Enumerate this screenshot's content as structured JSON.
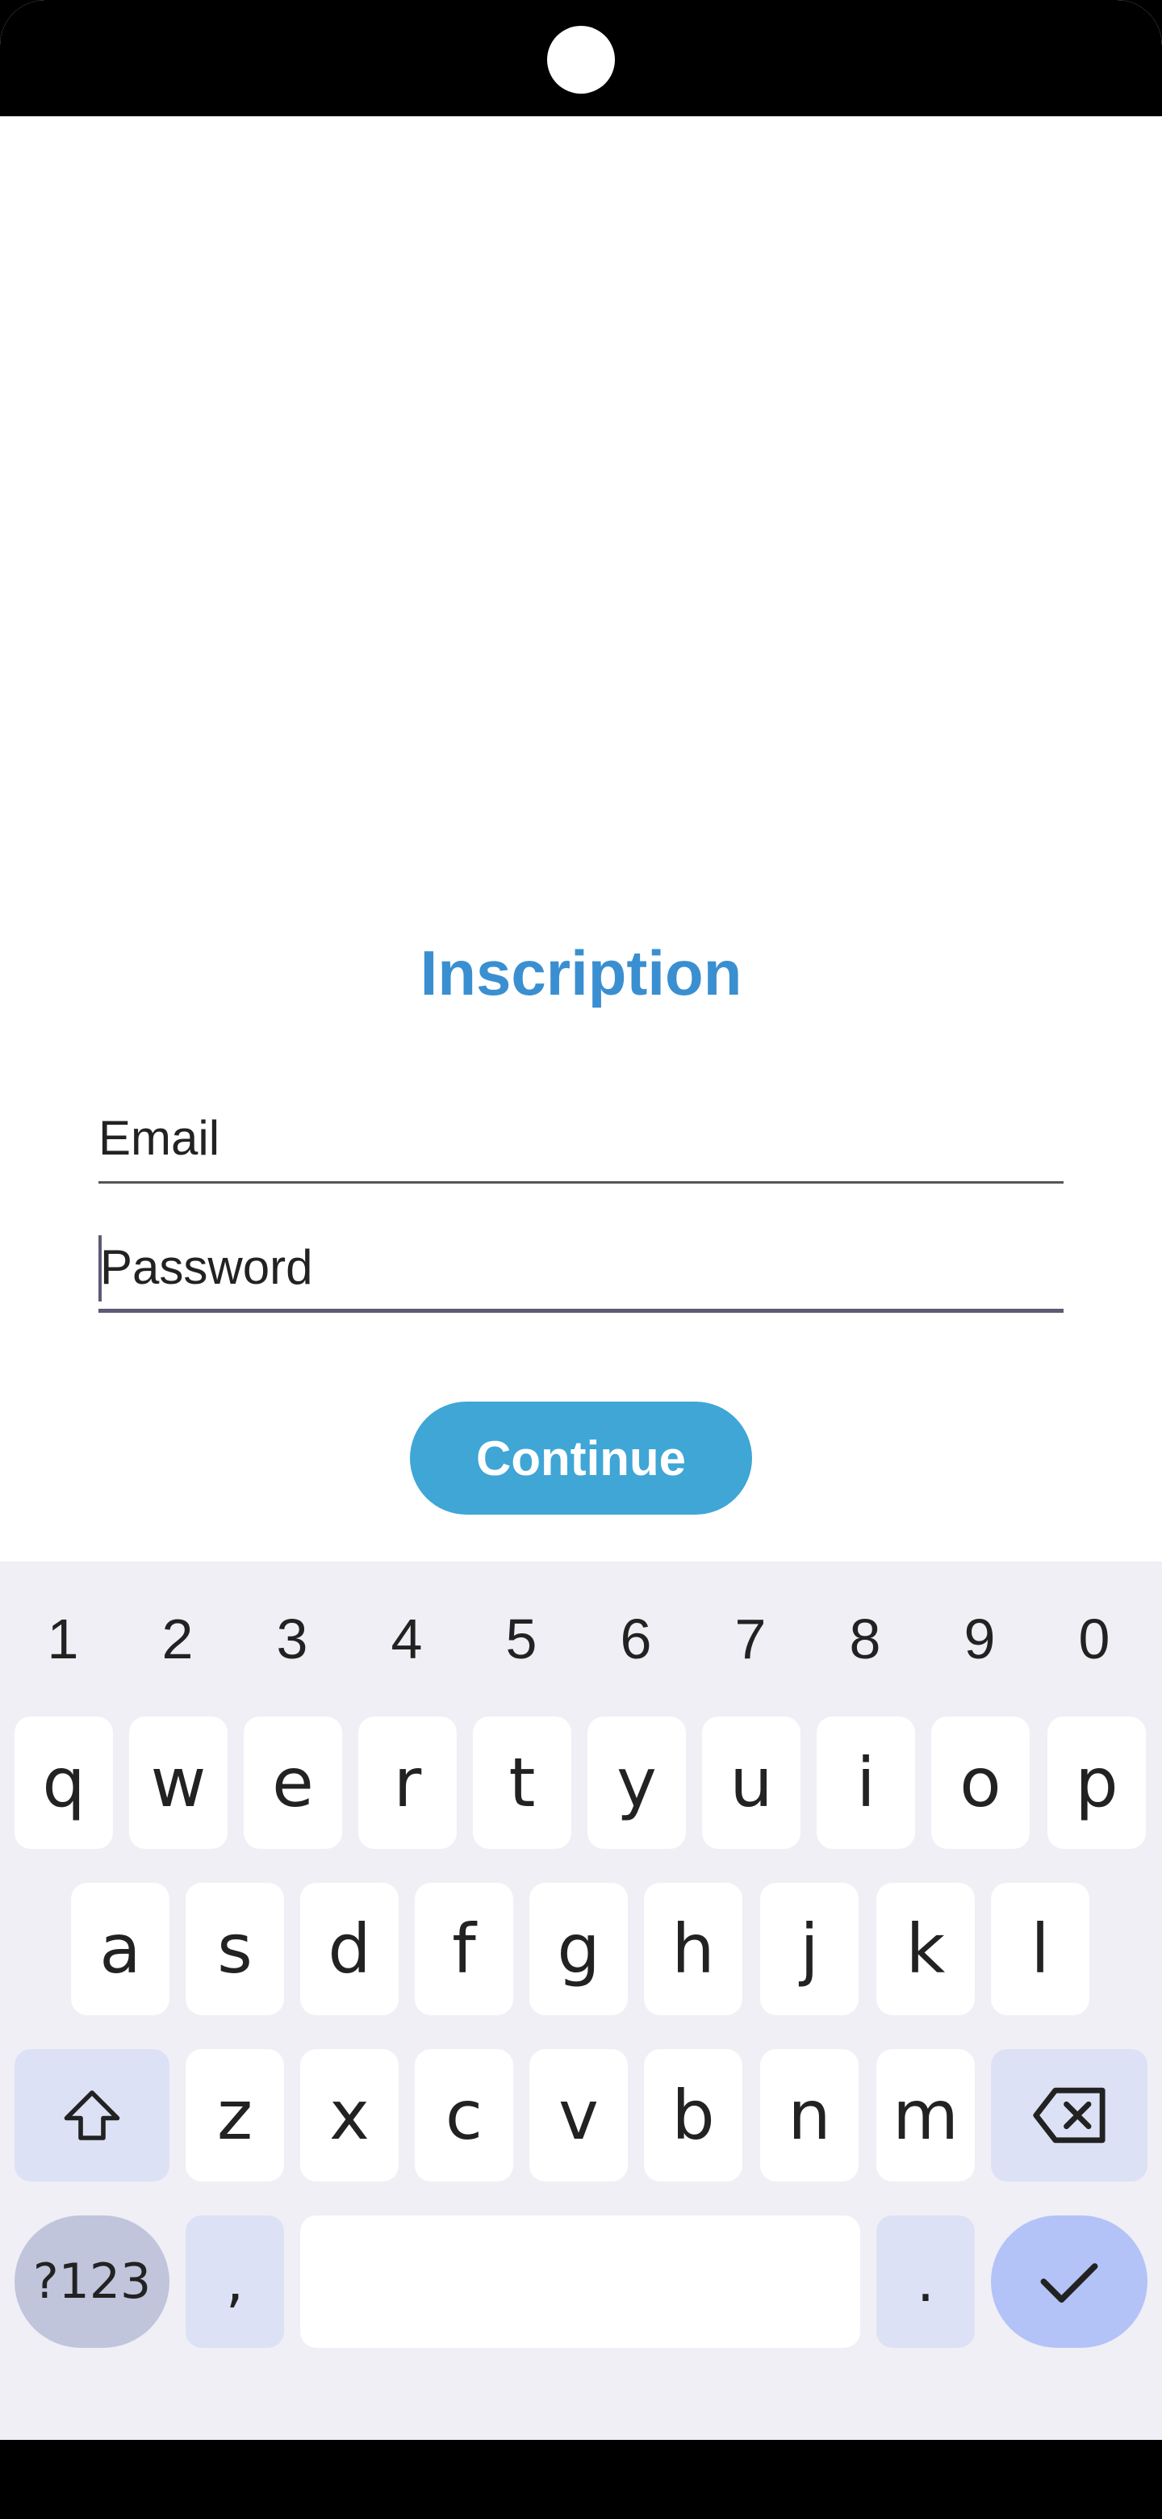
{
  "form": {
    "title": "Inscription",
    "email_placeholder": "Email",
    "password_placeholder": "Password",
    "continue_label": "Continue"
  },
  "keyboard": {
    "number_row": [
      "1",
      "2",
      "3",
      "4",
      "5",
      "6",
      "7",
      "8",
      "9",
      "0"
    ],
    "row1": [
      "q",
      "w",
      "e",
      "r",
      "t",
      "y",
      "u",
      "i",
      "o",
      "p"
    ],
    "row2": [
      "a",
      "s",
      "d",
      "f",
      "g",
      "h",
      "j",
      "k",
      "l"
    ],
    "row3": [
      "z",
      "x",
      "c",
      "v",
      "b",
      "n",
      "m"
    ],
    "symbols_label": "?123",
    "comma_label": ",",
    "period_label": "."
  },
  "colors": {
    "title": "#3a8fd1",
    "continue_button": "#3fa6d6",
    "keyboard_bg": "#efeff5",
    "enter_key": "#b3c3f8"
  },
  "icons": {
    "shift": "shift-icon",
    "backspace": "backspace-icon",
    "enter": "check-icon"
  }
}
